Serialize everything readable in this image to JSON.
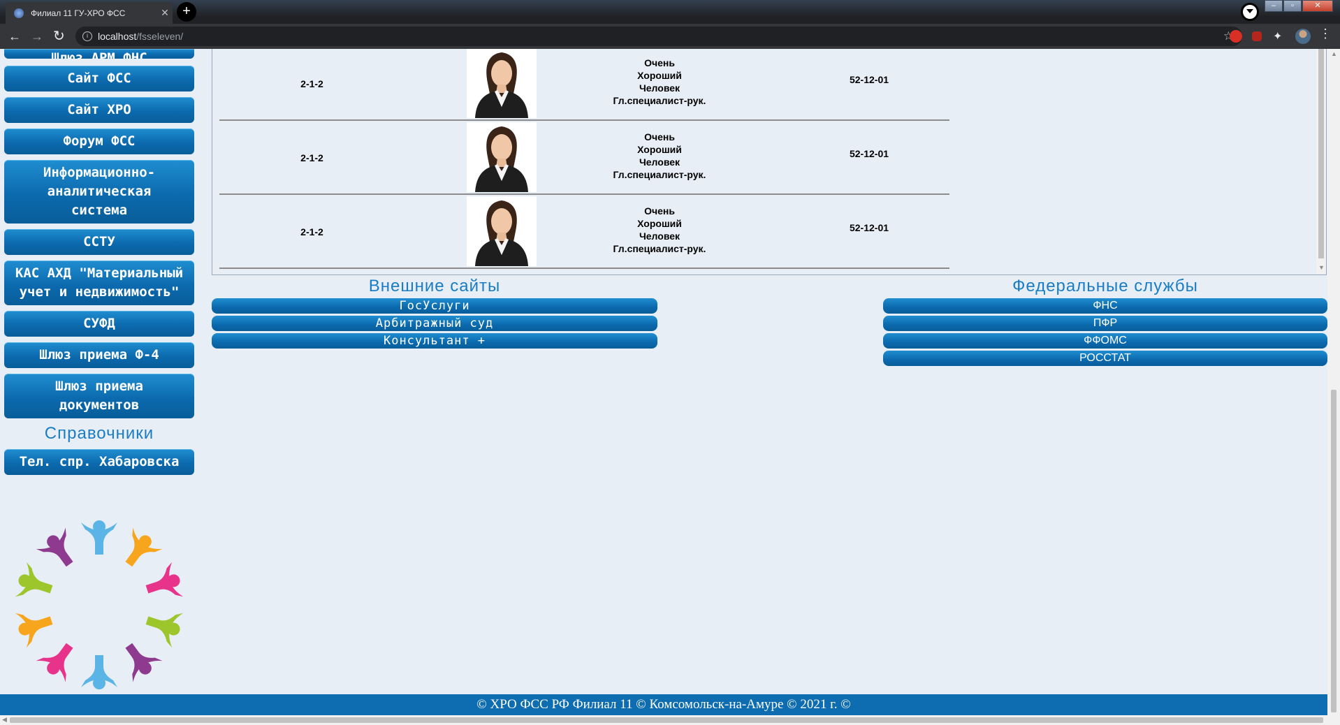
{
  "browser": {
    "tab_title": "Филиал 11 ГУ-ХРО ФСС",
    "tab_close": "✕",
    "new_tab": "+",
    "back": "←",
    "forward": "→",
    "reload": "↻",
    "url_host": "localhost",
    "url_path": "/fsseleven/",
    "info_icon": "i",
    "bookmark": "☆"
  },
  "sidebar": {
    "cut_button": "Шлюз АРМ ФНС",
    "buttons": [
      "Сайт ФСС",
      "Сайт ХРО",
      "Форум ФСС",
      "Информационно-аналитическая система",
      "ССТУ",
      "КАС АХД \"Материальный учет и недвижимость\"",
      "СУФД",
      "Шлюз приема Ф-4",
      "Шлюз приема документов"
    ],
    "references_heading": "Справочники",
    "reference_button": "Тел. спр. Хабаровска"
  },
  "staff_table": {
    "rows": [
      {
        "code": "2-1-2",
        "name": [
          "Очень",
          "Хороший",
          "Человек",
          "Гл.специалист-рук."
        ],
        "phone": "52-12-01"
      },
      {
        "code": "2-1-2",
        "name": [
          "Очень",
          "Хороший",
          "Человек",
          "Гл.специалист-рук."
        ],
        "phone": "52-12-01"
      },
      {
        "code": "2-1-2",
        "name": [
          "Очень",
          "Хороший",
          "Человек",
          "Гл.специалист-рук."
        ],
        "phone": "52-12-01"
      }
    ]
  },
  "external_sites": {
    "heading": "Внешние сайты",
    "links": [
      "ГосУслуги",
      "Арбитражный суд",
      "Консультант +"
    ]
  },
  "federal_services": {
    "heading": "Федеральные службы",
    "links": [
      "ФНС",
      "ПФР",
      "ФФОМС",
      "РОССТАТ"
    ]
  },
  "footer": {
    "text": "© ХРО ФСС РФ Филиал 11 © Комсомольск-на-Амуре © 2021 г. ©"
  },
  "colors": {
    "button_blue": "#0c6aae",
    "heading_blue": "#1a7dc4",
    "page_bg": "#e8eef6",
    "footer_bg": "#0e6db0"
  }
}
